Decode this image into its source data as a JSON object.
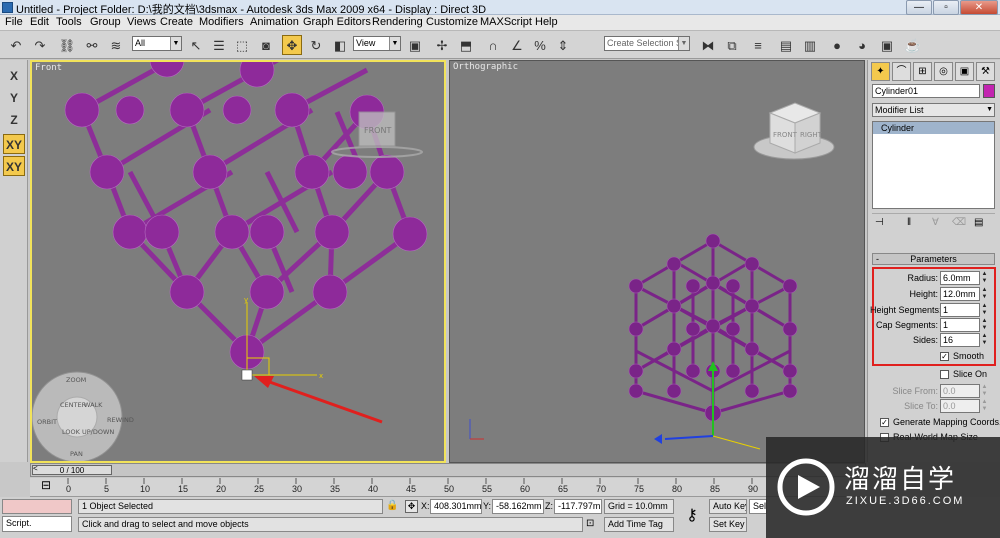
{
  "window": {
    "title": "Untitled    - Project Folder: D:\\我的文档\\3dsmax    - Autodesk 3ds Max  2009 x64    - Display : Direct 3D",
    "minimize": "—",
    "maximize": "▫",
    "close": "✕"
  },
  "menu": [
    "File",
    "Edit",
    "Tools",
    "Group",
    "Views",
    "Create",
    "Modifiers",
    "Animation",
    "Graph Editors",
    "Rendering",
    "Customize",
    "MAXScript",
    "Help"
  ],
  "toolbar": {
    "filter_select": "All",
    "refcoord_select": "View",
    "named_selection_placeholder": "Create Selection Set"
  },
  "axis_buttons": [
    "X",
    "Y",
    "Z",
    "XY",
    "XY"
  ],
  "viewports": {
    "front": {
      "label": "Front",
      "viewcube_face": "FRONT",
      "steering_wheel": {
        "zoom": "ZOOM",
        "orbit": "ORBIT",
        "center": "CENTER",
        "walk": "WALK",
        "rewind": "REWIND",
        "look": "LOOK",
        "updown": "UP/DOWN",
        "pan": "PAN"
      }
    },
    "ortho": {
      "label": "Orthographic",
      "viewcube_front": "FRONT",
      "viewcube_right": "RIGHT"
    },
    "colors": {
      "mesh": "#8e2a9a",
      "background": "#7d7d7d",
      "active_border": "#f2e35a"
    }
  },
  "command_panel": {
    "object_name": "Cylinder01",
    "object_color": "#c224b0",
    "modifier_list": "Modifier List",
    "stack_item": "Cylinder",
    "parameters_title": "Parameters",
    "params": [
      {
        "label": "Radius:",
        "value": "6.0mm"
      },
      {
        "label": "Height:",
        "value": "12.0mm"
      },
      {
        "label": "Height Segments:",
        "value": "1"
      },
      {
        "label": "Cap Segments:",
        "value": "1"
      },
      {
        "label": "Sides:",
        "value": "16"
      }
    ],
    "smooth": {
      "label": "Smooth",
      "checked": true
    },
    "slice_on": {
      "label": "Slice On",
      "checked": false
    },
    "slice_from": {
      "label": "Slice From:",
      "value": "0.0"
    },
    "slice_to": {
      "label": "Slice To:",
      "value": "0.0"
    },
    "gen_mapping": {
      "label": "Generate Mapping Coords.",
      "checked": true
    },
    "real_world": {
      "label": "Real-World Map Size",
      "checked": false
    }
  },
  "timeline": {
    "slider_label": "0 / 100",
    "ticks": [
      "0",
      "5",
      "10",
      "15",
      "20",
      "25",
      "30",
      "35",
      "40",
      "45",
      "50",
      "55",
      "60",
      "65",
      "70",
      "75",
      "80",
      "85",
      "90"
    ]
  },
  "status": {
    "script_label": "Script.",
    "selected": "1 Object Selected",
    "prompt": "Click and drag to select and move objects",
    "x_label": "X:",
    "x_value": "408.301mm",
    "y_label": "Y:",
    "y_value": "-58.162mm",
    "z_label": "Z:",
    "z_value": "-117.797mm",
    "grid": "Grid = 10.0mm",
    "add_time_tag": "Add Time Tag",
    "auto_key": "Auto Key",
    "set_key": "Set Key",
    "selected_short": "Sele"
  },
  "watermark": {
    "brand": "溜溜自学",
    "url": "ZIXUE.3D66.COM"
  }
}
